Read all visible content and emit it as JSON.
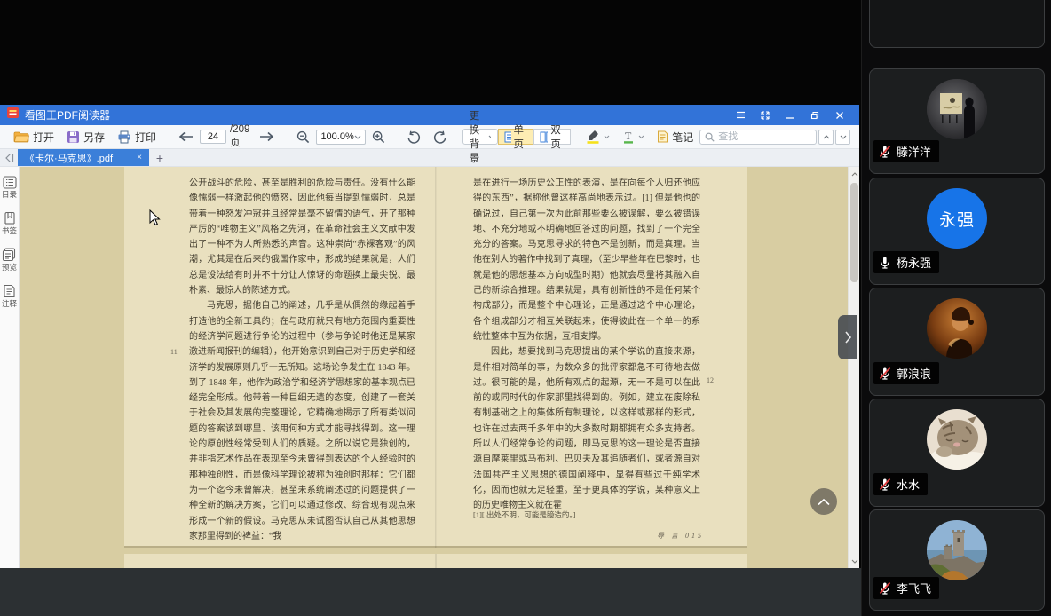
{
  "window": {
    "title": "看图王PDF阅读器",
    "controls": {
      "menu": "menu",
      "fullscreen": "fullscreen",
      "minimize": "minimize",
      "maximize": "restore",
      "close": "close"
    }
  },
  "toolbar": {
    "open_label": "打开",
    "save_label": "另存",
    "print_label": "打印",
    "page_current": "24",
    "page_total": "/209页",
    "zoom_value": "100.0%",
    "change_background_label": "更换背景",
    "single_page_label": "单页",
    "double_page_label": "双页",
    "notes_label": "笔记",
    "search_placeholder": "查找"
  },
  "tabs": {
    "active_title": "《卡尔·马克思》.pdf",
    "close_glyph": "×",
    "new_tab_glyph": "+"
  },
  "sidebar": {
    "items": [
      {
        "label": "目录"
      },
      {
        "label": "书签"
      },
      {
        "label": "预览"
      },
      {
        "label": "注释"
      }
    ]
  },
  "document": {
    "left_page": {
      "margin_number": "11",
      "paragraphs": [
        "公开战斗的危险，甚至是胜利的危险与责任。没有什么能像懦弱一样激起他的愤怒，因此他每当提到懦弱时，总是带着一种怒发冲冠并且经常是毫不留情的语气，开了那种严厉的“唯物主义”风格之先河，在革命社会主义文献中发出了一种不为人所熟悉的声音。这种崇尚“赤裸客观”的风潮，尤其是在后来的俄国作家中，形成的结果就是，人们总是设法给有时并不十分让人惊讶的命题换上最尖锐、最朴素、最惊人的陈述方式。",
        "马克思，据他自己的阐述，几乎是从偶然的缘起着手打造他的全新工具的；在与政府就只有地方范围内重要性的经济学问题进行争论的过程中（参与争论时他还是某家激进新闻报刊的编辑），他开始意识到自己对于历史学和经济学的发展原则几乎一无所知。这场论争发生在 1843 年。到了 1848 年，他作为政治学和经济学思想家的基本观点已经完全形成。他带着一种巨细无遗的态度，创建了一套关于社会及其发展的完整理论，它精确地揭示了所有类似问题的答案该到哪里、该用何种方式才能寻找得到。这一理论的原创性经常受到人们的质疑。之所以说它是独创的，并非指艺术作品在表现至今未曾得到表达的个人经验时的那种独创性，而是像科学理论被称为独创时那样：它们都为一个迄今未曾解决，甚至未系统阐述过的问题提供了一种全新的解决方案，它们可以通过修改、综合现有观点来形成一个新的假设。马克思从未试图否认自己从其他思想家那里得到的裨益：“我"
      ]
    },
    "right_page": {
      "margin_number": "12",
      "paragraphs": [
        "是在进行一场历史公正性的表演，是在向每个人归还他应得的东西”，据称他曾这样高尚地表示过。[1] 但是他也的确说过，自己第一次为此前那些要么被误解，要么被错误地、不充分地或不明确地回答过的问题，找到了一个完全充分的答案。马克思寻求的特色不是创新，而是真理。当他在别人的著作中找到了真理，（至少早些年在巴黎时，也就是他的思想基本方向成型时期）他就会尽量将其融入自己的新综合推理。结果就是，具有创新性的不是任何某个构成部分，而是整个中心理论，正是通过这个中心理论，各个组成部分才相互关联起来，使得彼此在一个单一的系统性整体中互为依据，互相支撑。",
        "因此，想要找到马克思提出的某个学说的直接来源，是件相对简单的事，为数众多的批评家都急不可待地去做过。很可能的是，他所有观点的起源，无一不是可以在此前的或同时代的作家那里找得到的。例如，建立在废除私有制基础之上的集体所有制理论，以这样或那样的形式，也许在过去两千多年中的大多数时期都拥有众多支持者。所以人们经常争论的问题，即马克思的这一理论是否直接源自摩莱里或马布利、巴贝夫及其追随者们，或者源自对法国共产主义思想的德国阐释中，显得有些过于纯学术化，因而也就无足轻重。至于更具体的学说，某种意义上的历史唯物主义就在霍"
      ],
      "footnote": "[1][ 出处不明，可能是臆造的。]",
      "footer": "导 言 015"
    }
  },
  "participants": [
    {
      "name": "滕洋洋",
      "muted": true,
      "avatar": "gallery-photo"
    },
    {
      "name": "杨永强",
      "muted": false,
      "avatar": "initials",
      "avatar_text": "永强",
      "avatar_color": "#1774e8"
    },
    {
      "name": "郭浪浪",
      "muted": true,
      "avatar": "portrait-photo"
    },
    {
      "name": "水水",
      "muted": true,
      "avatar": "cat-photo"
    },
    {
      "name": "李飞飞",
      "muted": true,
      "avatar": "castle-photo"
    }
  ],
  "colors": {
    "titlebar": "#3273d8",
    "active_tab": "#3b7fd9",
    "active_tool_bg": "#fdedb3",
    "viewer_bg": "#d8cda2",
    "page_bg": "#e9e0bf",
    "mute_red": "#e03e3e",
    "avatar_blue": "#1774e8"
  }
}
